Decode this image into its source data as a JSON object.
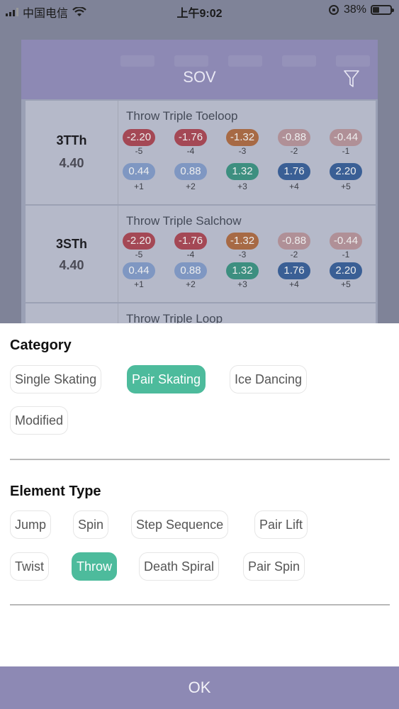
{
  "status_bar": {
    "carrier": "中国电信",
    "time": "上午9:02",
    "battery": "38%",
    "battery_level": 0.38
  },
  "background_app": {
    "title": "SOV",
    "elements": [
      {
        "code": "3TTh",
        "base_value": "4.40",
        "name": "Throw Triple Toeloop",
        "negative": [
          {
            "value": "-2.20",
            "goe": "-5"
          },
          {
            "value": "-1.76",
            "goe": "-4"
          },
          {
            "value": "-1.32",
            "goe": "-3"
          },
          {
            "value": "-0.88",
            "goe": "-2"
          },
          {
            "value": "-0.44",
            "goe": "-1"
          }
        ],
        "positive": [
          {
            "value": "0.44",
            "goe": "+1"
          },
          {
            "value": "0.88",
            "goe": "+2"
          },
          {
            "value": "1.32",
            "goe": "+3"
          },
          {
            "value": "1.76",
            "goe": "+4"
          },
          {
            "value": "2.20",
            "goe": "+5"
          }
        ]
      },
      {
        "code": "3STh",
        "base_value": "4.40",
        "name": "Throw Triple Salchow",
        "negative": [
          {
            "value": "-2.20",
            "goe": "-5"
          },
          {
            "value": "-1.76",
            "goe": "-4"
          },
          {
            "value": "-1.32",
            "goe": "-3"
          },
          {
            "value": "-0.88",
            "goe": "-2"
          },
          {
            "value": "-0.44",
            "goe": "-1"
          }
        ],
        "positive": [
          {
            "value": "0.44",
            "goe": "+1"
          },
          {
            "value": "0.88",
            "goe": "+2"
          },
          {
            "value": "1.32",
            "goe": "+3"
          },
          {
            "value": "1.76",
            "goe": "+4"
          },
          {
            "value": "2.20",
            "goe": "+5"
          }
        ]
      },
      {
        "name": "Throw Triple Loop"
      }
    ],
    "colors": {
      "neg": [
        "#a44855",
        "#a44855",
        "#a76a45",
        "#b09097",
        "#b09097"
      ],
      "pos": [
        "#7f97c2",
        "#7f97c2",
        "#3d8f80",
        "#3a5f95",
        "#3a5f95"
      ]
    }
  },
  "sheet": {
    "category_title": "Category",
    "category_options": [
      {
        "label": "Single Skating",
        "selected": false
      },
      {
        "label": "Pair Skating",
        "selected": true
      },
      {
        "label": "Ice Dancing",
        "selected": false
      },
      {
        "label": "Modified",
        "selected": false
      }
    ],
    "element_type_title": "Element Type",
    "element_type_options": [
      {
        "label": "Jump",
        "selected": false
      },
      {
        "label": "Spin",
        "selected": false
      },
      {
        "label": "Step Sequence",
        "selected": false
      },
      {
        "label": "Pair Lift",
        "selected": false
      },
      {
        "label": "Twist",
        "selected": false
      },
      {
        "label": "Throw",
        "selected": true
      },
      {
        "label": "Death Spiral",
        "selected": false
      },
      {
        "label": "Pair Spin",
        "selected": false
      }
    ],
    "ok_label": "OK",
    "accent_color": "#4dbb9c",
    "bar_color": "#8d89b4"
  }
}
